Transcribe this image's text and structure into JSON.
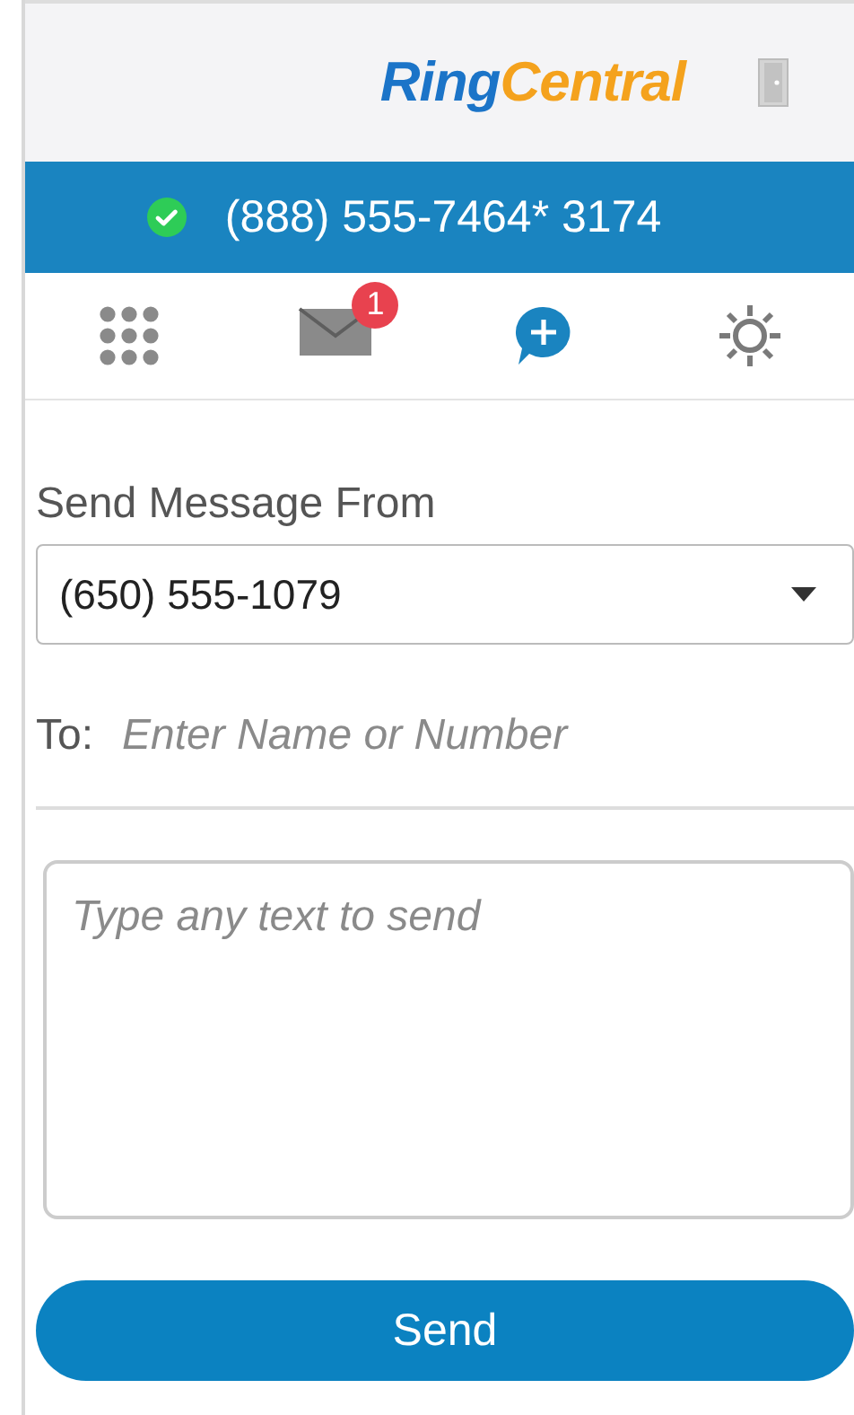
{
  "header": {
    "logo": [
      "Ring",
      "Central"
    ]
  },
  "status_bar": {
    "online": true,
    "number": "(888) 555-7464* 3174"
  },
  "tabs": [
    {
      "kind": "dialpad",
      "selected": false
    },
    {
      "kind": "messages",
      "selected": false,
      "badge": "1"
    },
    {
      "kind": "compose",
      "selected": true
    },
    {
      "kind": "settings",
      "selected": false
    }
  ],
  "form": {
    "from_label": "Send Message From",
    "from_value": "(650) 555-1079",
    "to_label": "To:",
    "to_placeholder": "Enter Name or Number",
    "message_placeholder": "Type any text to send",
    "send": "Send"
  }
}
